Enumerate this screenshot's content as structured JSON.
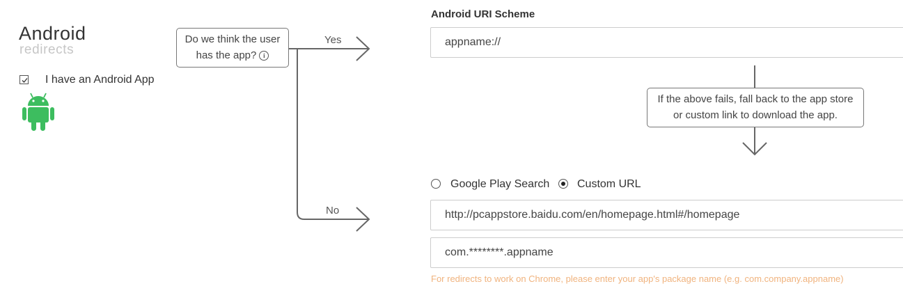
{
  "section": {
    "title": "Android",
    "subtitle": "redirects",
    "checkbox_label": "I have an Android App",
    "checkbox_checked": true,
    "logo_icon": "android-robot-icon",
    "logo_color": "#3dbd5f"
  },
  "flow": {
    "question_line1": "Do we think the user",
    "question_line2": "has the app?",
    "question_icon": "info-icon",
    "yes_label": "Yes",
    "no_label": "No"
  },
  "uri_scheme": {
    "label": "Android URI Scheme",
    "value": "appname://"
  },
  "fallback": {
    "line1": "If the above fails, fall back to the app store",
    "line2": "or custom link to download the app."
  },
  "fallback_options": {
    "options": [
      {
        "label": "Google Play Search",
        "selected": false
      },
      {
        "label": "Custom URL",
        "selected": true
      }
    ]
  },
  "custom_url": {
    "value": "http://pcappstore.baidu.com/en/homepage.html#/homepage"
  },
  "package_name": {
    "value": "com.********.appname",
    "hint": "For redirects to work on Chrome, please enter your app's package name (e.g. com.company.appname)",
    "hint_color": "#f0b37e"
  }
}
